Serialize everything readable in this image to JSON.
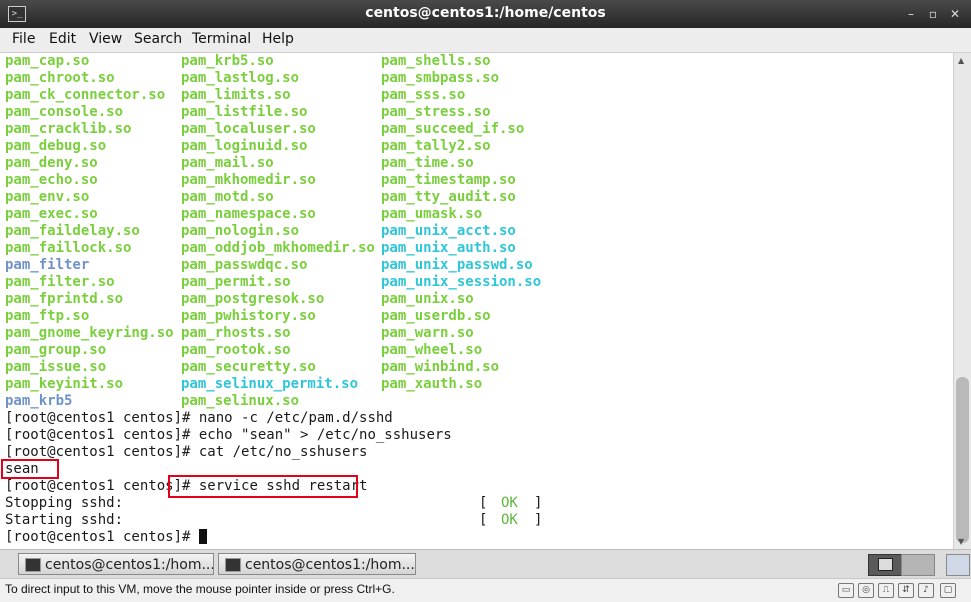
{
  "window": {
    "title": "centos@centos1:/home/centos",
    "icon": "terminal-icon",
    "controls": [
      "minimize-icon",
      "maximize-icon",
      "close-icon"
    ]
  },
  "menu": [
    "File",
    "Edit",
    "View",
    "Search",
    "Terminal",
    "Help"
  ],
  "listing": [
    {
      "cols": [
        {
          "t": "pam_cap.so",
          "c": "g"
        },
        {
          "t": "pam_krb5.so",
          "c": "g"
        },
        {
          "t": "pam_shells.so",
          "c": "g"
        }
      ]
    },
    {
      "cols": [
        {
          "t": "pam_chroot.so",
          "c": "g"
        },
        {
          "t": "pam_lastlog.so",
          "c": "g"
        },
        {
          "t": "pam_smbpass.so",
          "c": "g"
        }
      ]
    },
    {
      "cols": [
        {
          "t": "pam_ck_connector.so",
          "c": "g"
        },
        {
          "t": "pam_limits.so",
          "c": "g"
        },
        {
          "t": "pam_sss.so",
          "c": "g"
        }
      ]
    },
    {
      "cols": [
        {
          "t": "pam_console.so",
          "c": "g"
        },
        {
          "t": "pam_listfile.so",
          "c": "g"
        },
        {
          "t": "pam_stress.so",
          "c": "g"
        }
      ]
    },
    {
      "cols": [
        {
          "t": "pam_cracklib.so",
          "c": "g"
        },
        {
          "t": "pam_localuser.so",
          "c": "g"
        },
        {
          "t": "pam_succeed_if.so",
          "c": "g"
        }
      ]
    },
    {
      "cols": [
        {
          "t": "pam_debug.so",
          "c": "g"
        },
        {
          "t": "pam_loginuid.so",
          "c": "g"
        },
        {
          "t": "pam_tally2.so",
          "c": "g"
        }
      ]
    },
    {
      "cols": [
        {
          "t": "pam_deny.so",
          "c": "g"
        },
        {
          "t": "pam_mail.so",
          "c": "g"
        },
        {
          "t": "pam_time.so",
          "c": "g"
        }
      ]
    },
    {
      "cols": [
        {
          "t": "pam_echo.so",
          "c": "g"
        },
        {
          "t": "pam_mkhomedir.so",
          "c": "g"
        },
        {
          "t": "pam_timestamp.so",
          "c": "g"
        }
      ]
    },
    {
      "cols": [
        {
          "t": "pam_env.so",
          "c": "g"
        },
        {
          "t": "pam_motd.so",
          "c": "g"
        },
        {
          "t": "pam_tty_audit.so",
          "c": "g"
        }
      ]
    },
    {
      "cols": [
        {
          "t": "pam_exec.so",
          "c": "g"
        },
        {
          "t": "pam_namespace.so",
          "c": "g"
        },
        {
          "t": "pam_umask.so",
          "c": "g"
        }
      ]
    },
    {
      "cols": [
        {
          "t": "pam_faildelay.so",
          "c": "g"
        },
        {
          "t": "pam_nologin.so",
          "c": "g"
        },
        {
          "t": "pam_unix_acct.so",
          "c": "c"
        }
      ]
    },
    {
      "cols": [
        {
          "t": "pam_faillock.so",
          "c": "g"
        },
        {
          "t": "pam_oddjob_mkhomedir.so",
          "c": "g"
        },
        {
          "t": "pam_unix_auth.so",
          "c": "c"
        }
      ]
    },
    {
      "cols": [
        {
          "t": "pam_filter",
          "c": "b"
        },
        {
          "t": "pam_passwdqc.so",
          "c": "g"
        },
        {
          "t": "pam_unix_passwd.so",
          "c": "c"
        }
      ]
    },
    {
      "cols": [
        {
          "t": "pam_filter.so",
          "c": "g"
        },
        {
          "t": "pam_permit.so",
          "c": "g"
        },
        {
          "t": "pam_unix_session.so",
          "c": "c"
        }
      ]
    },
    {
      "cols": [
        {
          "t": "pam_fprintd.so",
          "c": "g"
        },
        {
          "t": "pam_postgresok.so",
          "c": "g"
        },
        {
          "t": "pam_unix.so",
          "c": "g"
        }
      ]
    },
    {
      "cols": [
        {
          "t": "pam_ftp.so",
          "c": "g"
        },
        {
          "t": "pam_pwhistory.so",
          "c": "g"
        },
        {
          "t": "pam_userdb.so",
          "c": "g"
        }
      ]
    },
    {
      "cols": [
        {
          "t": "pam_gnome_keyring.so",
          "c": "g"
        },
        {
          "t": "pam_rhosts.so",
          "c": "g"
        },
        {
          "t": "pam_warn.so",
          "c": "g"
        }
      ]
    },
    {
      "cols": [
        {
          "t": "pam_group.so",
          "c": "g"
        },
        {
          "t": "pam_rootok.so",
          "c": "g"
        },
        {
          "t": "pam_wheel.so",
          "c": "g"
        }
      ]
    },
    {
      "cols": [
        {
          "t": "pam_issue.so",
          "c": "g"
        },
        {
          "t": "pam_securetty.so",
          "c": "g"
        },
        {
          "t": "pam_winbind.so",
          "c": "g"
        }
      ]
    },
    {
      "cols": [
        {
          "t": "pam_keyinit.so",
          "c": "g"
        },
        {
          "t": "pam_selinux_permit.so",
          "c": "c"
        },
        {
          "t": "pam_xauth.so",
          "c": "g"
        }
      ]
    },
    {
      "cols": [
        {
          "t": "pam_krb5",
          "c": "b"
        },
        {
          "t": "pam_selinux.so",
          "c": "g"
        }
      ]
    }
  ],
  "session": {
    "prompt": "[root@centos1 centos]# ",
    "cmd_nano": "nano -c /etc/pam.d/sshd",
    "cmd_echo": "echo \"sean\" > /etc/no_sshusers",
    "cmd_cat": "cat /etc/no_sshusers",
    "output_sean": "sean",
    "prompt_restart": "[root@centos1 centos]",
    "cmd_restart": "# service sshd restart",
    "stopping": "Stopping sshd:",
    "starting": "Starting sshd:",
    "bracket_open": "[",
    "ok": "OK",
    "bracket_close": "]",
    "final_prompt": "[root@centos1 centos]# "
  },
  "taskbar": {
    "items": [
      "centos@centos1:/hom...",
      "centos@centos1:/hom..."
    ]
  },
  "statusbar": {
    "message": "To direct input to this VM, move the mouse pointer inside or press Ctrl+G.",
    "icons": [
      "hdd-icon",
      "cdrom-icon",
      "usb-icon",
      "network-icon",
      "sound-icon",
      "message-icon"
    ]
  }
}
